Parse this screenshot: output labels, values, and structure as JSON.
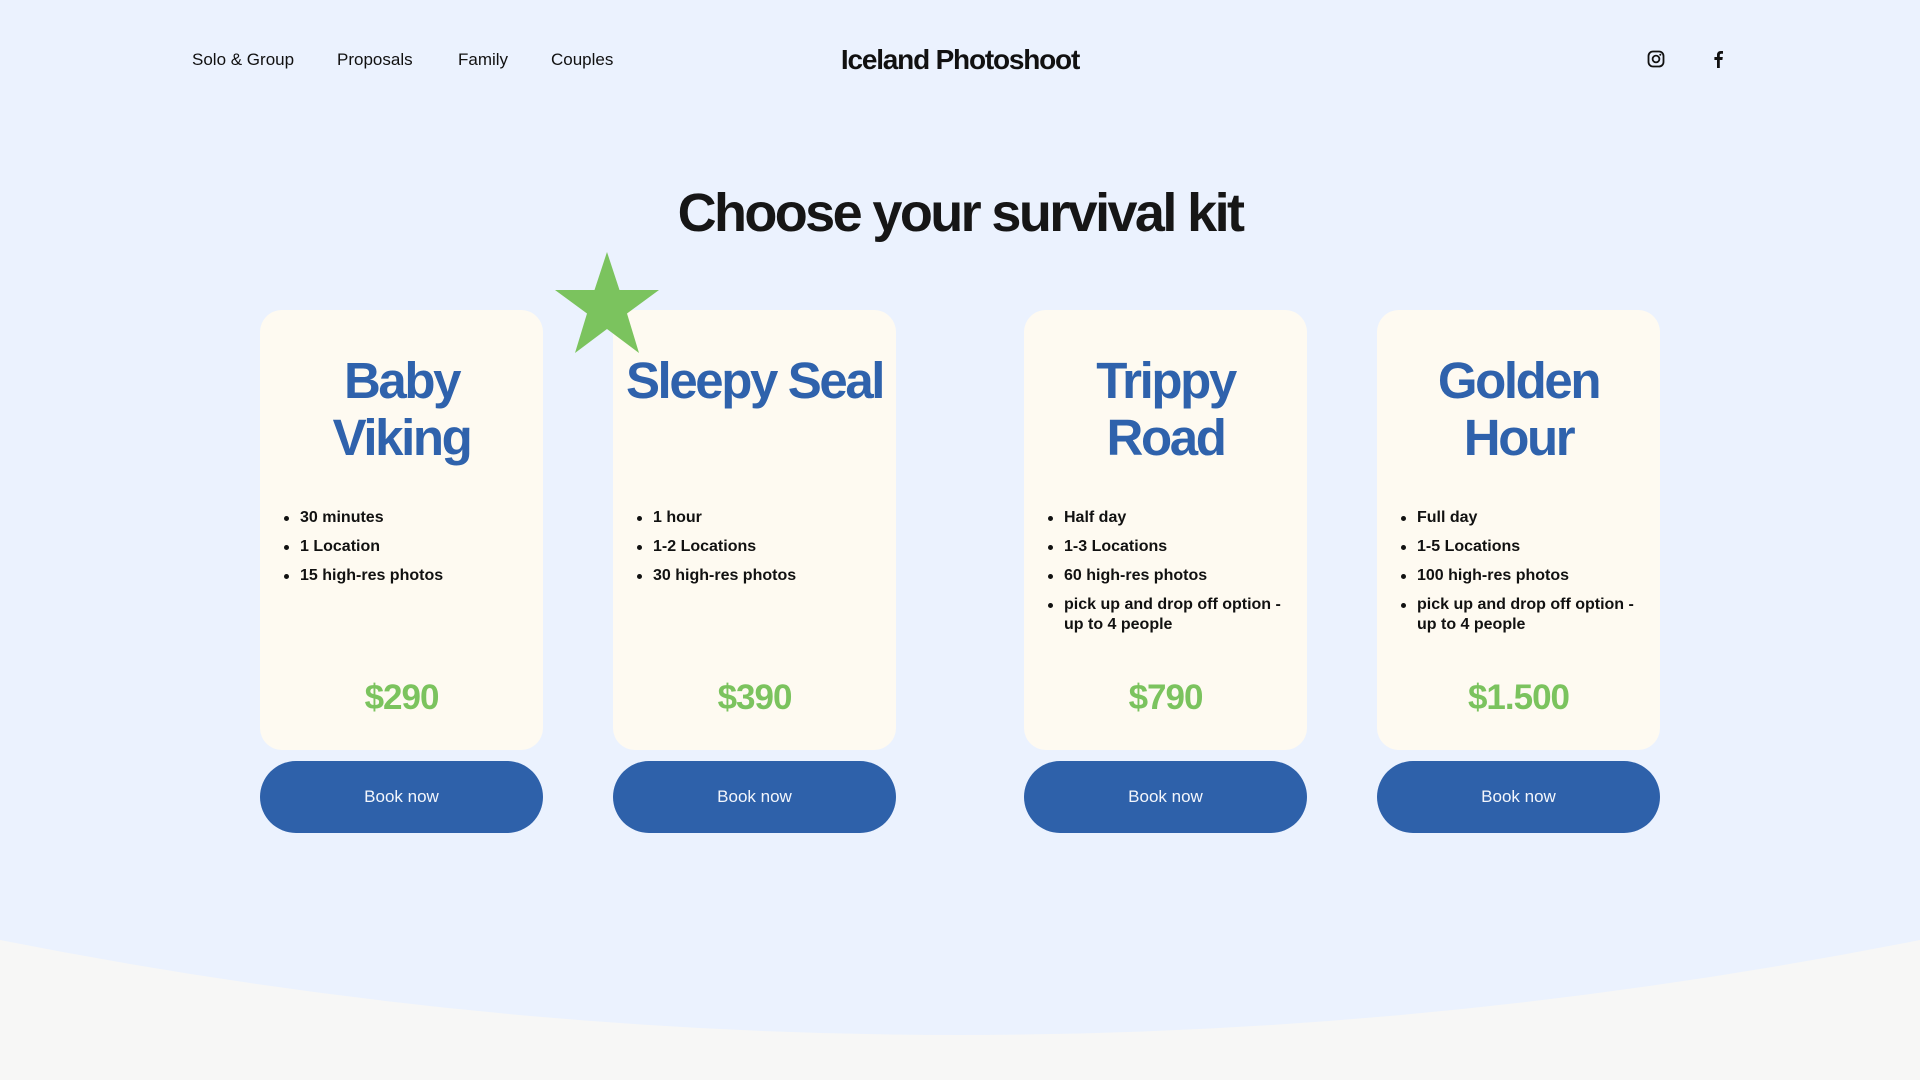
{
  "nav": {
    "links": [
      "Solo & Group",
      "Proposals",
      "Family",
      "Couples"
    ],
    "logo": "Iceland Photoshoot",
    "social": [
      "instagram-icon",
      "facebook-icon"
    ]
  },
  "headline": "Choose your survival kit",
  "colors": {
    "background": "#ebf2fe",
    "card": "#fefaf1",
    "title_blue": "#2f62ac",
    "price_green": "#7bc35e",
    "button_blue": "#2e61aa",
    "star_green": "#7bc35e"
  },
  "packages": [
    {
      "title_line1": "Baby",
      "title_line2": "Viking",
      "features": [
        "30 minutes",
        "1 Location",
        "15 high-res photos"
      ],
      "price": "$290",
      "button": "Book now"
    },
    {
      "title_line1": "Sleepy Seal",
      "title_line2": "",
      "features": [
        "1 hour",
        "1-2 Locations",
        "30 high-res photos"
      ],
      "price": "$390",
      "button": "Book now"
    },
    {
      "title_line1": "Trippy",
      "title_line2": "Road",
      "features": [
        "Half day",
        "1-3 Locations",
        "60 high-res photos",
        "pick up and drop off option - up to 4 people"
      ],
      "price": "$790",
      "button": "Book now"
    },
    {
      "title_line1": "Golden",
      "title_line2": "Hour",
      "features": [
        "Full day",
        "1-5 Locations",
        "100 high-res photos",
        "pick up and drop off option - up to 4 people"
      ],
      "price": "$1.500",
      "button": "Book now"
    }
  ]
}
